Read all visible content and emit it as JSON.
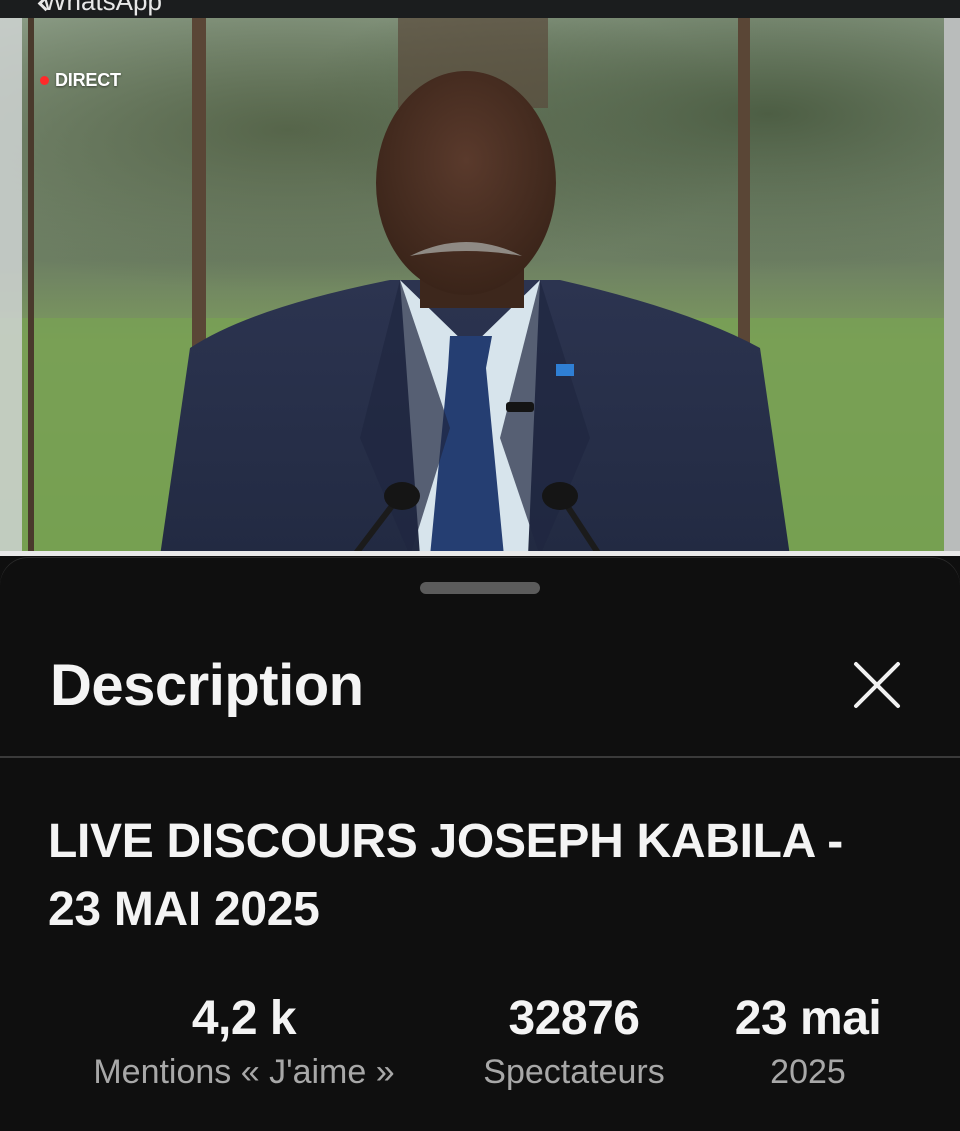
{
  "status_bar": {
    "back_label": "WhatsApp"
  },
  "player": {
    "live_label": "DIRECT",
    "live_color": "#ff2a2a",
    "progress_fraction": 1.0
  },
  "sheet": {
    "title": "Description",
    "close_icon": "close-icon",
    "video_title": "LIVE DISCOURS JOSEPH KABILA - 23 MAI 2025",
    "stats": {
      "likes": {
        "value": "4,2 k",
        "label": "Mentions « J'aime »"
      },
      "viewers": {
        "value": "32876",
        "label": "Spectateurs"
      },
      "date": {
        "value": "23 mai",
        "label": "2025"
      }
    }
  },
  "colors": {
    "background": "#0f0f0f",
    "text": "#f1f1f1",
    "secondary_text": "#a8a8a8"
  }
}
